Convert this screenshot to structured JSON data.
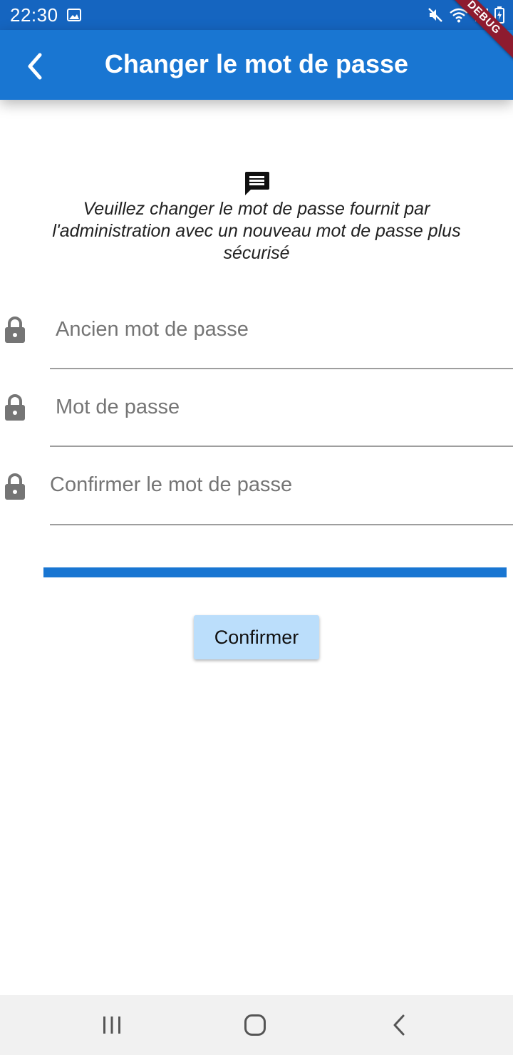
{
  "status_bar": {
    "time": "22:30",
    "icons": [
      "gallery-icon",
      "mute-icon",
      "wifi-icon",
      "signal-icon",
      "battery-icon"
    ]
  },
  "app_bar": {
    "title": "Changer le mot de passe",
    "back_icon": "chevron-left-icon"
  },
  "debug_banner": "DEBUG",
  "message": {
    "icon": "message-icon",
    "text": "Veuillez changer le mot de passe fournit par l'administration avec un nouveau mot de passe plus sécurisé"
  },
  "form": {
    "old_password": {
      "placeholder": "Ancien mot de passe",
      "value": "",
      "icon": "lock-icon"
    },
    "new_password": {
      "placeholder": "Mot de passe",
      "value": "",
      "icon": "lock-icon"
    },
    "confirm_password": {
      "placeholder": "Confirmer le mot de passe",
      "value": "",
      "icon": "lock-icon"
    }
  },
  "password_strength": {
    "fraction": 1.0
  },
  "confirm_button": {
    "label": "Confirmer"
  },
  "nav_bar": {
    "icons": [
      "recent-apps-icon",
      "home-icon",
      "back-icon"
    ]
  },
  "colors": {
    "status_bar": "#1565c0",
    "app_bar": "#1976d2",
    "accent": "#1976d2",
    "button_bg": "#bbdefb",
    "debug_banner": "#8e1b2f"
  }
}
